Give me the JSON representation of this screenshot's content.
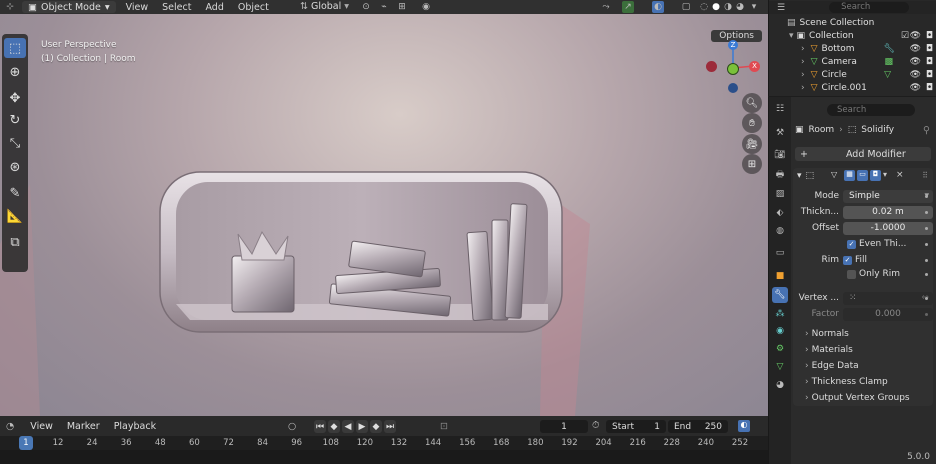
{
  "header": {
    "mode": "Object Mode",
    "menus": [
      "View",
      "Select",
      "Add",
      "Object"
    ],
    "transform": "Global"
  },
  "viewport": {
    "perspective": "User Perspective",
    "collection": "(1) Collection | Room",
    "options": "Options",
    "gizmo": {
      "z": "Z",
      "y": "Y",
      "x": "X"
    }
  },
  "timeline": {
    "menus": [
      "View",
      "Marker",
      "Playback"
    ],
    "current_frame": "1",
    "start_label": "Start",
    "start": "1",
    "end_label": "End",
    "end": "250",
    "frames": [
      "1",
      "12",
      "24",
      "36",
      "48",
      "60",
      "72",
      "84",
      "96",
      "108",
      "120",
      "132",
      "144",
      "156",
      "168",
      "180",
      "192",
      "204",
      "216",
      "228",
      "240",
      "252"
    ]
  },
  "outliner": {
    "search_placeholder": "Search",
    "scene_collection": "Scene Collection",
    "collection": "Collection",
    "items": [
      "Bottom",
      "Camera",
      "Circle",
      "Circle.001"
    ]
  },
  "properties": {
    "search_placeholder": "Search",
    "breadcrumb_object": "Room",
    "breadcrumb_modifier": "Solidify",
    "add_modifier": "Add Modifier",
    "mode_label": "Mode",
    "mode_value": "Simple",
    "thickness_label": "Thickn...",
    "thickness_value": "0.02 m",
    "offset_label": "Offset",
    "offset_value": "-1.0000",
    "even_thickness": "Even Thi...",
    "rim_label": "Rim",
    "fill": "Fill",
    "only_rim": "Only Rim",
    "vertex_group_label": "Vertex ...",
    "factor_label": "Factor",
    "factor_value": "0.000",
    "subpanels": [
      "Normals",
      "Materials",
      "Edge Data",
      "Thickness Clamp",
      "Output Vertex Groups"
    ]
  },
  "status": {
    "version": "5.0.0"
  },
  "colors": {
    "accent": "#4772b3",
    "x_axis": "#e04a52",
    "y_axis": "#7ac13a",
    "z_axis": "#3a7bd5"
  }
}
